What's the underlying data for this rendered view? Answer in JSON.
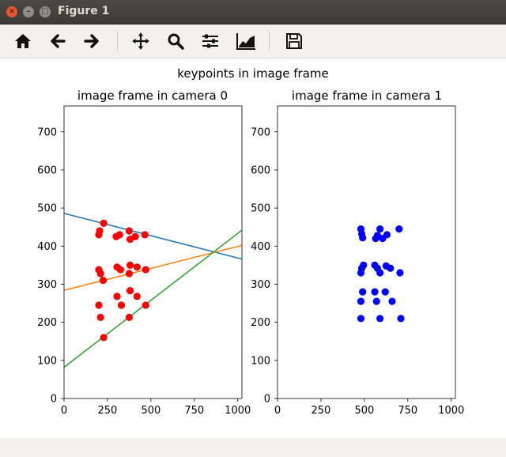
{
  "window": {
    "title": "Figure 1"
  },
  "toolbar": {
    "tools": [
      {
        "name": "home-icon",
        "label": "Home"
      },
      {
        "name": "back-icon",
        "label": "Back"
      },
      {
        "name": "forward-icon",
        "label": "Forward"
      },
      {
        "name": "pan-icon",
        "label": "Pan"
      },
      {
        "name": "zoom-icon",
        "label": "Zoom"
      },
      {
        "name": "subplots-icon",
        "label": "Subplots"
      },
      {
        "name": "customize-icon",
        "label": "Customize"
      },
      {
        "name": "save-icon",
        "label": "Save"
      }
    ]
  },
  "figure": {
    "suptitle": "keypoints in image frame"
  },
  "chart_data": [
    {
      "type": "scatter",
      "title": "image frame in camera 0",
      "xlabel": "",
      "ylabel": "",
      "xlim": [
        0,
        1024
      ],
      "ylim": [
        0,
        768
      ],
      "xticks": [
        0,
        250,
        500,
        750,
        1000
      ],
      "yticks": [
        0,
        100,
        200,
        300,
        400,
        500,
        600,
        700
      ],
      "grid": false,
      "series": [
        {
          "color": "#ff0000",
          "points": [
            [
              228,
              460
            ],
            [
              205,
              440
            ],
            [
              200,
              430
            ],
            [
              300,
              425
            ],
            [
              320,
              430
            ],
            [
              375,
              440
            ],
            [
              380,
              418
            ],
            [
              410,
              425
            ],
            [
              465,
              430
            ],
            [
              200,
              338
            ],
            [
              210,
              328
            ],
            [
              225,
              310
            ],
            [
              305,
              345
            ],
            [
              325,
              338
            ],
            [
              375,
              328
            ],
            [
              380,
              350
            ],
            [
              420,
              345
            ],
            [
              470,
              338
            ],
            [
              200,
              245
            ],
            [
              305,
              268
            ],
            [
              330,
              245
            ],
            [
              380,
              283
            ],
            [
              420,
              268
            ],
            [
              470,
              245
            ],
            [
              210,
              213
            ],
            [
              375,
              213
            ],
            [
              228,
              160
            ]
          ]
        }
      ],
      "lines": [
        {
          "color": "#1f77b4",
          "points": [
            [
              0,
              486
            ],
            [
              1024,
              366
            ]
          ]
        },
        {
          "color": "#ff7f0e",
          "points": [
            [
              0,
              284
            ],
            [
              1024,
              402
            ]
          ]
        },
        {
          "color": "#2ca02c",
          "points": [
            [
              0,
              82
            ],
            [
              1024,
              442
            ]
          ]
        }
      ]
    },
    {
      "type": "scatter",
      "title": "image frame in camera 1",
      "xlabel": "",
      "ylabel": "",
      "xlim": [
        0,
        1024
      ],
      "ylim": [
        0,
        768
      ],
      "xticks": [
        0,
        250,
        500,
        750,
        1000
      ],
      "yticks": [
        0,
        100,
        200,
        300,
        400,
        500,
        600,
        700
      ],
      "grid": false,
      "series": [
        {
          "color": "#0000ff",
          "points": [
            [
              480,
              445
            ],
            [
              485,
              432
            ],
            [
              490,
              422
            ],
            [
              565,
              420
            ],
            [
              575,
              428
            ],
            [
              590,
              445
            ],
            [
              605,
              420
            ],
            [
              630,
              430
            ],
            [
              700,
              445
            ],
            [
              480,
              330
            ],
            [
              485,
              342
            ],
            [
              495,
              350
            ],
            [
              560,
              350
            ],
            [
              575,
              342
            ],
            [
              590,
              330
            ],
            [
              625,
              348
            ],
            [
              650,
              342
            ],
            [
              705,
              330
            ],
            [
              490,
              280
            ],
            [
              560,
              280
            ],
            [
              620,
              280
            ],
            [
              480,
              255
            ],
            [
              570,
              255
            ],
            [
              660,
              255
            ],
            [
              480,
              210
            ],
            [
              590,
              210
            ],
            [
              710,
              210
            ]
          ]
        }
      ]
    }
  ]
}
